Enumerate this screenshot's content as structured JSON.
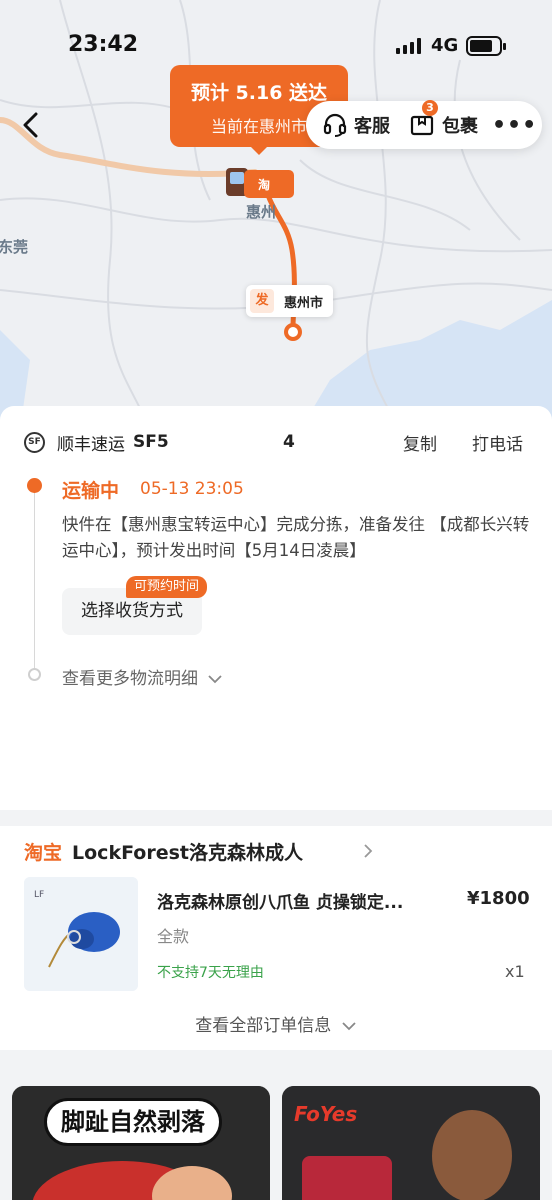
{
  "status_bar": {
    "time": "23:42",
    "network": "4G"
  },
  "map": {
    "eta_title": "预计 5.16 送达",
    "eta_sub": "当前在惠州市",
    "customer_service": "客服",
    "packages": "包裹",
    "packages_badge": "3",
    "city_dongguan": "东莞",
    "city_huizhou": "惠州",
    "origin_tag": "发",
    "origin_name": "惠州市",
    "truck_logo": "淘"
  },
  "tracking": {
    "carrier": "顺丰速运",
    "tracking_no_head": "SF5",
    "tracking_no_tail": "4",
    "copy": "复制",
    "call": "打电话",
    "status": "运输中",
    "status_time": "05-13 23:05",
    "detail": "快件在【惠州惠宝转运中心】完成分拣，准备发往 【成都长兴转运中心】，预计发出时间【5月14日凌晨】",
    "choose_delivery": "选择收货方式",
    "choose_tag": "可预约时间",
    "more_detail": "查看更多物流明细"
  },
  "order": {
    "platform": "淘宝",
    "shop": "LockForest洛克森林成人",
    "product_name": "洛克森林原创八爪鱼 贞操锁定...",
    "price": "¥1800",
    "spec": "全款",
    "no_return": "不支持7天无理由",
    "quantity": "x1",
    "view_all": "查看全部订单信息"
  },
  "ads": {
    "ad1_text": "脚趾自然剥落",
    "ad2_logo": "FoYes"
  },
  "colors": {
    "accent": "#ee6a26",
    "green": "#3aa24a"
  }
}
